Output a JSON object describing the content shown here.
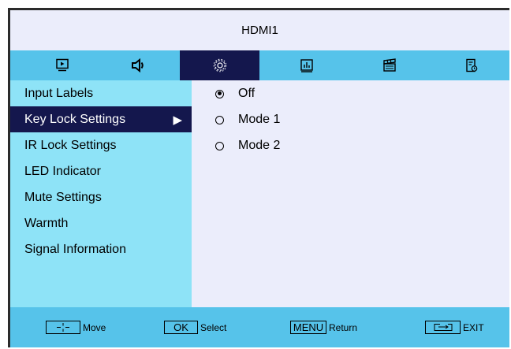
{
  "title": "HDMI1",
  "tabs": [
    {
      "icon": "picture-icon",
      "active": false
    },
    {
      "icon": "speaker-icon",
      "active": false
    },
    {
      "icon": "gear-icon",
      "active": true
    },
    {
      "icon": "equalizer-icon",
      "active": false
    },
    {
      "icon": "clapperboard-icon",
      "active": false
    },
    {
      "icon": "schedule-icon",
      "active": false
    }
  ],
  "sidebar": {
    "items": [
      {
        "label": "Input Labels"
      },
      {
        "label": "Key Lock Settings",
        "selected": true,
        "arrow": "▶"
      },
      {
        "label": "IR Lock Settings"
      },
      {
        "label": "LED Indicator"
      },
      {
        "label": "Mute Settings"
      },
      {
        "label": "Warmth"
      },
      {
        "label": "Signal Information"
      }
    ]
  },
  "options": [
    {
      "label": "Off",
      "checked": true
    },
    {
      "label": "Mode 1",
      "checked": false
    },
    {
      "label": "Mode 2",
      "checked": false
    }
  ],
  "footer": {
    "move_label": "Move",
    "ok_key": "OK",
    "select_label": "Select",
    "menu_key": "MENU",
    "return_label": "Return",
    "exit_label": "EXIT"
  },
  "colors": {
    "accent_dark": "#14174d",
    "tab_bar": "#56c3ea",
    "sidebar": "#8ee3f7",
    "panel": "#ebedfb"
  }
}
